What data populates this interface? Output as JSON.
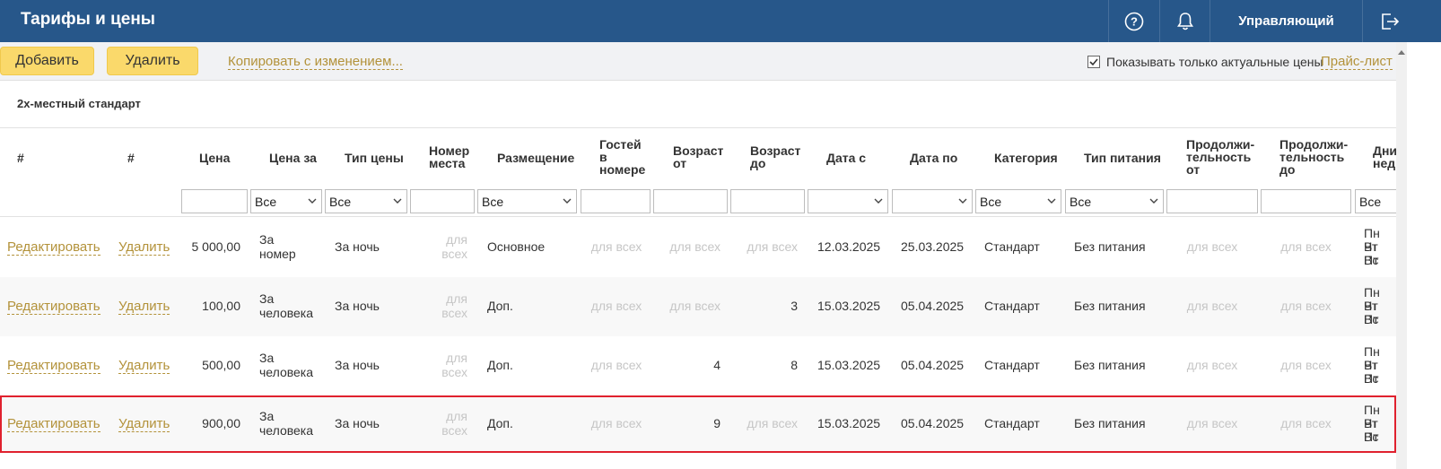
{
  "header": {
    "title": "Тарифы и цены",
    "user": "Управляющий"
  },
  "toolbar": {
    "add_label": "Добавить",
    "delete_label": "Удалить",
    "copy_label": "Копировать с изменением...",
    "actual_prices_label": "Показывать только актуальные цены",
    "actual_prices_checked": true,
    "price_list_label": "Прайс-лист"
  },
  "room_title": "2х-местный стандарт",
  "columns": {
    "c0": "#",
    "c1": "#",
    "price": "Цена",
    "price_for": "Цена за",
    "price_type": "Тип цены",
    "place_l1": "Номер",
    "place_l2": "места",
    "accommodation": "Размещение",
    "guests_l1": "Гостей",
    "guests_l2": "в",
    "guests_l3": "номере",
    "age_from_l1": "Возраст",
    "age_from_l2": "от",
    "age_to_l1": "Возраст",
    "age_to_l2": "до",
    "date_from": "Дата с",
    "date_to": "Дата по",
    "category": "Категория",
    "meal": "Тип питания",
    "dur_from_l1": "Продолжи-",
    "dur_from_l2": "тельность",
    "dur_from_l3": "от",
    "dur_to_l1": "Продолжи-",
    "dur_to_l2": "тельность",
    "dur_to_l3": "до",
    "days_l1": "Дни",
    "days_l2": "нед"
  },
  "filters": {
    "price_for": "Все",
    "price_type": "Все",
    "accommodation": "Все",
    "category": "Все",
    "meal": "Все",
    "days": "Все"
  },
  "row_actions": {
    "edit": "Редактировать",
    "delete": "Удалить"
  },
  "rows": [
    {
      "price": "5 000,00",
      "for_l1": "За",
      "for_l2": "номер",
      "type": "За ночь",
      "place_l1": "для",
      "place_l2": "всех",
      "accommodation": "Основное",
      "guests": "для всех",
      "age_from": "для всех",
      "age_to": "для всех",
      "date_from": "12.03.2025",
      "date_to": "25.03.2025",
      "category": "Стандарт",
      "meal": "Без питания",
      "dur_from": "для всех",
      "dur_to": "для всех",
      "days_l1": "Пн Вт",
      "days_l2": "Чт Пт",
      "days_l3": "Вс"
    },
    {
      "price": "100,00",
      "for_l1": "За",
      "for_l2": "человека",
      "type": "За ночь",
      "place_l1": "для",
      "place_l2": "всех",
      "accommodation": "Доп.",
      "guests": "для всех",
      "age_from": "для всех",
      "age_to": "3",
      "date_from": "15.03.2025",
      "date_to": "05.04.2025",
      "category": "Стандарт",
      "meal": "Без питания",
      "dur_from": "для всех",
      "dur_to": "для всех",
      "days_l1": "Пн Вт",
      "days_l2": "Чт Пт",
      "days_l3": "Вс"
    },
    {
      "price": "500,00",
      "for_l1": "За",
      "for_l2": "человека",
      "type": "За ночь",
      "place_l1": "для",
      "place_l2": "всех",
      "accommodation": "Доп.",
      "guests": "для всех",
      "age_from": "4",
      "age_to": "8",
      "date_from": "15.03.2025",
      "date_to": "05.04.2025",
      "category": "Стандарт",
      "meal": "Без питания",
      "dur_from": "для всех",
      "dur_to": "для всех",
      "days_l1": "Пн Вт",
      "days_l2": "Чт Пт",
      "days_l3": "Вс"
    },
    {
      "price": "900,00",
      "for_l1": "За",
      "for_l2": "человека",
      "type": "За ночь",
      "place_l1": "для",
      "place_l2": "всех",
      "accommodation": "Доп.",
      "guests": "для всех",
      "age_from": "9",
      "age_to": "для всех",
      "date_from": "15.03.2025",
      "date_to": "05.04.2025",
      "category": "Стандарт",
      "meal": "Без питания",
      "dur_from": "для всех",
      "dur_to": "для всех",
      "days_l1": "Пн Вт",
      "days_l2": "Чт Пт",
      "days_l3": "Вс"
    }
  ],
  "colors": {
    "header_bg": "#27578a",
    "button_yellow": "#fad96b",
    "link": "#b3923a",
    "highlight_border": "#e0212e"
  }
}
